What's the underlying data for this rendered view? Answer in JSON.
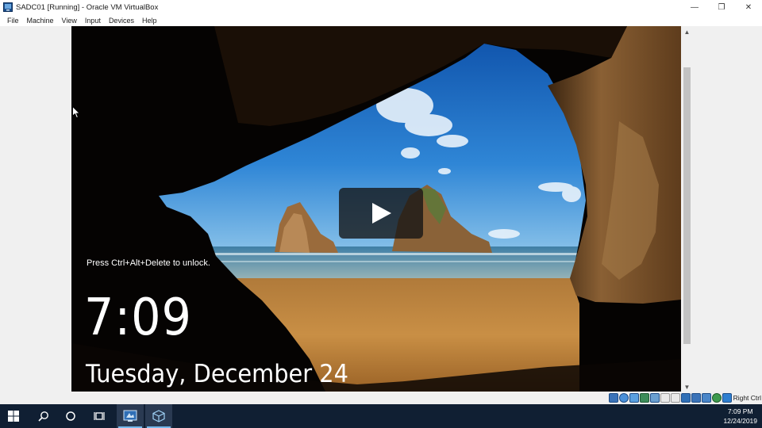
{
  "window": {
    "title": "SADC01 [Running] - Oracle VM VirtualBox",
    "minimize_glyph": "—",
    "restore_glyph": "❐",
    "close_glyph": "✕"
  },
  "menu": {
    "items": [
      "File",
      "Machine",
      "View",
      "Input",
      "Devices",
      "Help"
    ]
  },
  "lockscreen": {
    "unlock_prompt": "Press Ctrl+Alt+Delete to unlock.",
    "time": "7:09",
    "date": "Tuesday, December 24"
  },
  "statusbar": {
    "host_key": "Right Ctrl",
    "icons": [
      "hard-disk-icon",
      "optical-drive-icon",
      "audio-icon",
      "network-icon",
      "usb-icon",
      "shared-folders-icon",
      "display-icon",
      "video-capture-icon",
      "mouse-integration-icon",
      "keyboard-icon",
      "cpu-icon",
      "arrow-down-icon"
    ]
  },
  "taskbar": {
    "clock_time": "7:09 PM",
    "clock_date": "12/24/2019"
  },
  "colors": {
    "taskbar_bg": "#101f33",
    "accent": "#76b9ed"
  }
}
